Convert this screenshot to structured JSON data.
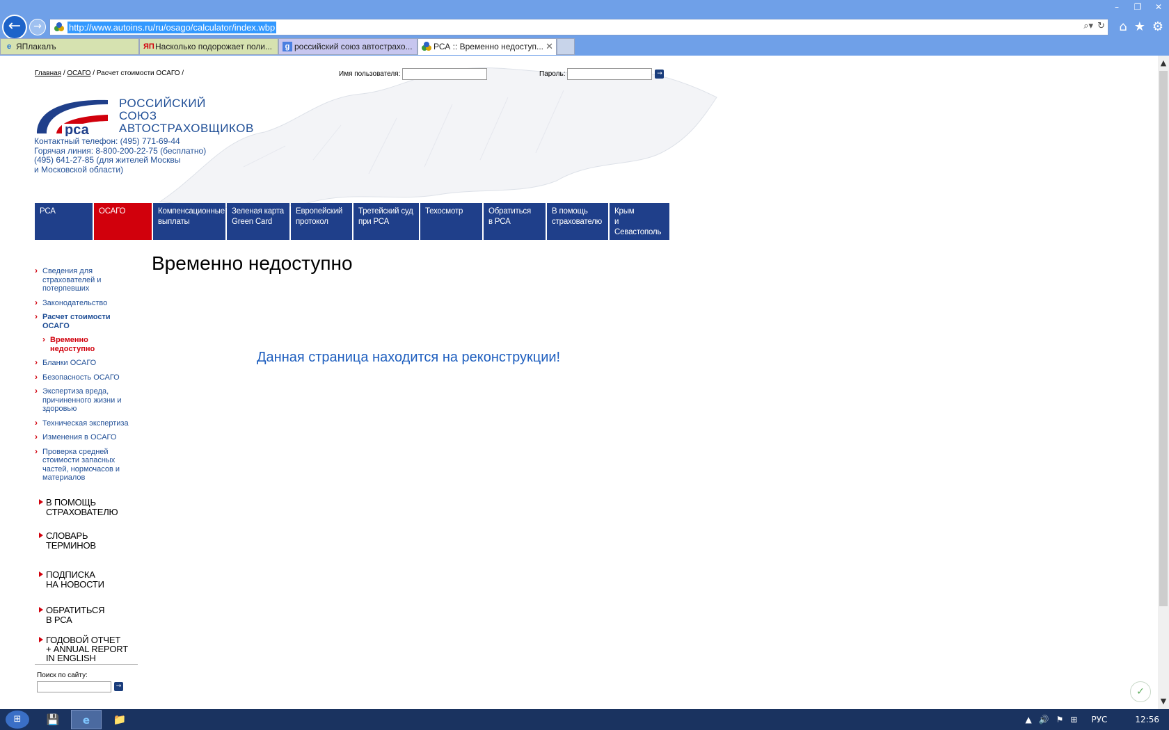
{
  "browser": {
    "url": "http://www.autoins.ru/ru/osago/calculator/index.wbp",
    "tabs": [
      {
        "label": "ЯПлакалъ",
        "icon": "ie-icon"
      },
      {
        "label": "Насколько подорожает поли...",
        "icon": "yap-icon"
      },
      {
        "label": "российский союз автострахо...",
        "icon": "google-icon"
      },
      {
        "label": "РСА :: Временно недоступ...",
        "icon": "rsa-favicon"
      }
    ],
    "active_tab_index": 3,
    "window_controls": {
      "minimize": "–",
      "restore": "❐",
      "close": "✕"
    },
    "nav": {
      "back": "←",
      "forward": "→",
      "search_glyph": "⌕▾",
      "refresh": "↻",
      "home": "⌂",
      "favorites": "★",
      "settings": "⚙"
    }
  },
  "page": {
    "breadcrumb": {
      "home": "Главная",
      "sep1": "/",
      "osago": "ОСАГО",
      "sep2": "/",
      "current": "Расчет стоимости ОСАГО /"
    },
    "login": {
      "username_label": "Имя пользователя:",
      "password_label": "Пароль:",
      "go": "→"
    },
    "org_name": [
      "РОССИЙСКИЙ",
      "СОЮЗ",
      "АВТОСТРАХОВЩИКОВ"
    ],
    "logo_text": "рса",
    "contacts": [
      "Контактный телефон:  (495) 771-69-44",
      "Горячая линия:  8-800-200-22-75  (бесплатно)",
      "(495) 641-27-85 (для жителей Москвы",
      "и Московской области)"
    ],
    "menu": [
      {
        "label": "РСА",
        "active": false
      },
      {
        "label": "ОСАГО",
        "active": true
      },
      {
        "label": "Компенсационные\nвыплаты",
        "active": false
      },
      {
        "label": "Зеленая карта\nGreen Card",
        "active": false
      },
      {
        "label": "Европейский\nпротокол",
        "active": false
      },
      {
        "label": "Третейский суд\nпри РСА",
        "active": false
      },
      {
        "label": "Техосмотр",
        "active": false
      },
      {
        "label": "Обратиться\nв РСА",
        "active": false
      },
      {
        "label": "В помощь\nстрахователю",
        "active": false
      },
      {
        "label": "Крым\nи Севастополь",
        "active": false
      }
    ],
    "sidebar_links": [
      {
        "label": "Сведения для страхователей и потерпевших",
        "style": ""
      },
      {
        "label": "Законодательство",
        "style": ""
      },
      {
        "label": "Расчет стоимости ОСАГО",
        "style": "bold"
      },
      {
        "label": "Временно недоступно",
        "style": "sub"
      },
      {
        "label": "Бланки ОСАГО",
        "style": ""
      },
      {
        "label": "Безопасность ОСАГО",
        "style": ""
      },
      {
        "label": "Экспертиза вреда, причиненного жизни и здоровью",
        "style": ""
      },
      {
        "label": "Техническая экспертиза",
        "style": ""
      },
      {
        "label": "Изменения в ОСАГО",
        "style": ""
      },
      {
        "label": "Проверка средней стоимости запасных частей, нормочасов и материалов",
        "style": ""
      }
    ],
    "sidebar_blocks": [
      "В ПОМОЩЬ\nСТРАХОВАТЕЛЮ",
      "СЛОВАРЬ\nТЕРМИНОВ",
      "ПОДПИСКА\nНА НОВОСТИ",
      "ОБРАТИТЬСЯ\nВ РСА",
      "ГОДОВОЙ ОТЧЕТ\n+ ANNUAL REPORT\nIN ENGLISH"
    ],
    "search_label": "Поиск по сайту:",
    "title": "Временно недоступно",
    "message": "Данная страница находится на реконструкции!"
  },
  "taskbar": {
    "clock": "12:56",
    "lang": "РУС",
    "tray_icons": [
      "▲",
      "🔊",
      "⚑",
      "⊞"
    ],
    "apps": [
      "💾",
      "e",
      "📁"
    ]
  },
  "colors": {
    "brand_blue": "#1f3f8a",
    "brand_red": "#d1000c",
    "link_blue": "#1f4e96"
  }
}
